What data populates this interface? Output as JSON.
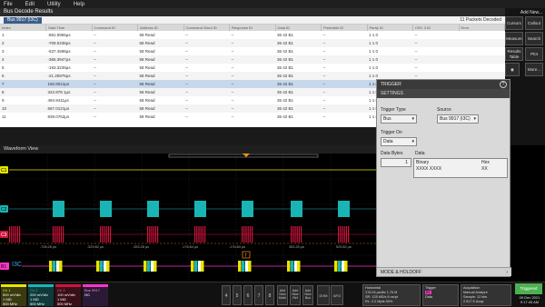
{
  "menu": [
    "File",
    "Edit",
    "Utility",
    "Help"
  ],
  "results": {
    "title": "Bus Decode Results",
    "bus": "Bus 9917 (I3C)",
    "packets": "11 Packets Decoded",
    "columns": [
      "Index",
      "Start Time",
      "Command ID",
      "Address ID",
      "Command Word ID",
      "Response ID",
      "Data ID",
      "Preamble ID",
      "Parity ID",
      "CRC 3 ID",
      "Error"
    ],
    "rows": [
      [
        "1",
        "-881.5955μs",
        "--",
        "58 Read",
        "--",
        "--",
        "36 42 B1",
        "--",
        "1 1 0",
        "--",
        ""
      ],
      [
        "2",
        "-709.5238μs",
        "--",
        "58 Read",
        "--",
        "--",
        "36 42 B1",
        "--",
        "1 1 0",
        "--",
        ""
      ],
      [
        "3",
        "-537.4598μs",
        "--",
        "58 Read",
        "--",
        "--",
        "36 42 B1",
        "--",
        "1 1 0",
        "--",
        ""
      ],
      [
        "4",
        "-365.3947μs",
        "--",
        "58 Read",
        "--",
        "--",
        "36 42 B1",
        "--",
        "1 1 0",
        "--",
        ""
      ],
      [
        "5",
        "-193.3239μs",
        "--",
        "58 Read",
        "--",
        "--",
        "36 42 B1",
        "--",
        "1 1 0",
        "--",
        ""
      ],
      [
        "6",
        "-21.25976μs",
        "--",
        "58 Read",
        "--",
        "--",
        "36 42 B1",
        "--",
        "1 1 0",
        "--",
        ""
      ],
      [
        "7",
        "150.8012μs",
        "--",
        "58 Read",
        "--",
        "--",
        "36 42 B1",
        "--",
        "1 1 0",
        "--",
        ""
      ],
      [
        "8",
        "322.878 1μs",
        "--",
        "58 Read",
        "--",
        "--",
        "36 42 B1",
        "--",
        "1 1 0",
        "--",
        ""
      ],
      [
        "9",
        "494.9411μs",
        "--",
        "58 Read",
        "--",
        "--",
        "36 42 B1",
        "--",
        "1 1 0",
        "--",
        ""
      ],
      [
        "10",
        "667.0121μs",
        "--",
        "58 Read",
        "--",
        "--",
        "36 42 B1",
        "--",
        "1 1 0",
        "--",
        ""
      ],
      [
        "11",
        "839.0762μs",
        "--",
        "58 Read",
        "--",
        "--",
        "36 42 B1",
        "--",
        "1 1 0",
        "--",
        ""
      ]
    ]
  },
  "right_panel": {
    "add_new": "Add New...",
    "buttons": [
      "Cursors",
      "Callout",
      "Measure",
      "Search",
      "Results Table",
      "Plot",
      "More..."
    ]
  },
  "waveform": {
    "title": "Waveform View",
    "time_labels": [
      "-706.28 μs",
      "-529.82 μs",
      "-353.28 μs",
      "-176.84 μs",
      "-176.84 μs",
      "353.28 μs",
      "529.82 μs"
    ],
    "ch1_label": "C1",
    "ch2_label": "C2",
    "ch3_label": "C3",
    "bus_label": "B1",
    "bus_name": "I3C",
    "colors": {
      "ch1": "#e6e600",
      "ch2": "#19b5b5",
      "ch3": "#d0143c",
      "bus": "#ff33cc",
      "marker": "#ff8c1a"
    }
  },
  "trigger": {
    "title": "TRIGGER",
    "settings": "SETTINGS",
    "trigger_type_label": "Trigger Type",
    "trigger_type": "Bus",
    "source_label": "Source",
    "source": "Bus 9917 (I3C)",
    "trigger_on_label": "Trigger On",
    "trigger_on": "Data",
    "data_bytes_label": "Data Bytes",
    "data_bytes": "1",
    "data_label": "Data",
    "binary_label": "Binary",
    "binary_value": "XXXX XXXX",
    "hex_label": "Hex",
    "hex_value": "XX",
    "mode": "MODE & HOLDOFF"
  },
  "bottom": {
    "ch1": {
      "name": "Ch 1",
      "l1": "500 mV/div",
      "l2": "1 MΩ",
      "l3": "500 MHz"
    },
    "ch2": {
      "name": "Ch 2",
      "l1": "200 mV/div",
      "l2": "1 MΩ",
      "l3": "500 MHz"
    },
    "ch3": {
      "name": "Ch 3",
      "l1": "100 mV/div",
      "l2": "1 MΩ",
      "l3": "500 MHz"
    },
    "bus": {
      "name": "Bus 9917",
      "l1": "I3C",
      "l2": ""
    },
    "scope_nums": [
      "4",
      "5",
      "6",
      "7",
      "8"
    ],
    "add_new": [
      "Add New Math",
      "Add New Ref",
      "Add New Bus"
    ],
    "dvm": "DVM",
    "afg": "AFG",
    "horizontal": {
      "title": "Horizontal",
      "l1": "176.04 μs/div",
      "l2": "1.76 M",
      "l3": "SR: 125 MS/s",
      "l4": "8 ns/pt",
      "l5": "RL: 2.2 Mpts",
      "l6": "50%"
    },
    "trigger": {
      "title": "Trigger",
      "l1": "B1",
      "l2": "Data"
    },
    "acquisition": {
      "title": "Acquisition",
      "l1": "Manual",
      "l2": "Analyze",
      "l3": "Sample: 12 bits",
      "l4": "2.517 K Acqs"
    },
    "triggered": "Triggered",
    "date": "09 Dec 2021",
    "time": "9:17:45 AM"
  }
}
